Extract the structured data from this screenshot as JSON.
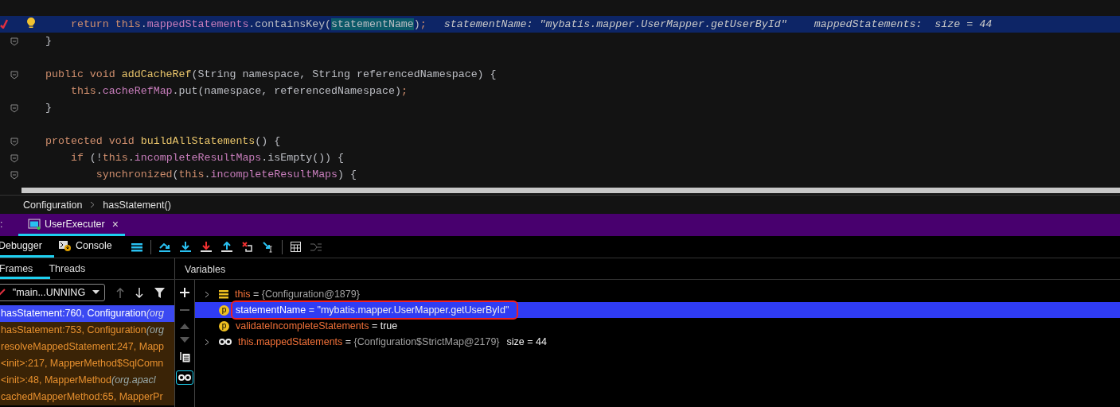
{
  "editor": {
    "lines": [
      {
        "kind": "code",
        "current": true,
        "breakpoint": true,
        "intention": true,
        "fold": false,
        "tokens": [
          {
            "kind": "kw",
            "text": "    return "
          },
          {
            "kind": "kw",
            "text": "this"
          },
          {
            "kind": "plain",
            "text": "."
          },
          {
            "kind": "field",
            "text": "mappedStatements"
          },
          {
            "kind": "plain",
            "text": ".containsKey("
          },
          {
            "kind": "usage",
            "text": "statementName"
          },
          {
            "kind": "plain",
            "text": ")"
          },
          {
            "kind": "punct",
            "text": ";"
          }
        ],
        "hints": [
          "statementName: \"mybatis.mapper.UserMapper.getUserById\"",
          "mappedStatements:  size = 44"
        ]
      },
      {
        "kind": "code",
        "current": false,
        "breakpoint": false,
        "intention": false,
        "fold": true,
        "tokens": [
          {
            "kind": "plain",
            "text": "}"
          }
        ]
      },
      {
        "kind": "blank"
      },
      {
        "kind": "code",
        "current": false,
        "breakpoint": false,
        "intention": false,
        "fold": true,
        "tokens": [
          {
            "kind": "kw",
            "text": "public void "
          },
          {
            "kind": "decl",
            "text": "addCacheRef"
          },
          {
            "kind": "plain",
            "text": "(String namespace, String referencedNamespace) {"
          }
        ]
      },
      {
        "kind": "code",
        "current": false,
        "breakpoint": false,
        "intention": false,
        "fold": false,
        "tokens": [
          {
            "kind": "kw",
            "text": "    this"
          },
          {
            "kind": "plain",
            "text": "."
          },
          {
            "kind": "field",
            "text": "cacheRefMap"
          },
          {
            "kind": "plain",
            "text": ".put(namespace, referencedNamespace)"
          },
          {
            "kind": "punct",
            "text": ";"
          }
        ]
      },
      {
        "kind": "code",
        "current": false,
        "breakpoint": false,
        "intention": false,
        "fold": true,
        "tokens": [
          {
            "kind": "plain",
            "text": "}"
          }
        ]
      },
      {
        "kind": "blank"
      },
      {
        "kind": "code",
        "current": false,
        "breakpoint": false,
        "intention": false,
        "fold": true,
        "tokens": [
          {
            "kind": "kw",
            "text": "protected void "
          },
          {
            "kind": "decl",
            "text": "buildAllStatements"
          },
          {
            "kind": "plain",
            "text": "() {"
          }
        ]
      },
      {
        "kind": "code",
        "current": false,
        "breakpoint": false,
        "intention": false,
        "fold": true,
        "tokens": [
          {
            "kind": "kw",
            "text": "    if "
          },
          {
            "kind": "plain",
            "text": "(!"
          },
          {
            "kind": "kw",
            "text": "this"
          },
          {
            "kind": "plain",
            "text": "."
          },
          {
            "kind": "field",
            "text": "incompleteResultMaps"
          },
          {
            "kind": "plain",
            "text": ".isEmpty()) {"
          }
        ]
      },
      {
        "kind": "code",
        "current": false,
        "breakpoint": false,
        "intention": false,
        "fold": true,
        "tokens": [
          {
            "kind": "kw",
            "text": "        synchronized"
          },
          {
            "kind": "plain",
            "text": "("
          },
          {
            "kind": "kw",
            "text": "this"
          },
          {
            "kind": "plain",
            "text": "."
          },
          {
            "kind": "field",
            "text": "incompleteResultMaps"
          },
          {
            "kind": "plain",
            "text": ") {"
          }
        ]
      }
    ]
  },
  "breadcrumb": [
    "Configuration",
    "hasStatement()"
  ],
  "tool_window": {
    "title": ":",
    "tab": {
      "label": "UserExecuter",
      "close": "×"
    }
  },
  "debug_tabs": [
    {
      "label": "Debugger",
      "selected": true
    },
    {
      "label": "Console",
      "selected": false
    }
  ],
  "frames_tabs": [
    {
      "label": "Frames",
      "selected": true
    },
    {
      "label": "Threads",
      "selected": false
    }
  ],
  "variables_title": "Variables",
  "thread_select": {
    "value": "\"main...UNNING"
  },
  "frames": [
    {
      "location": "hasStatement:760, Configuration",
      "package": "(org",
      "selected": true
    },
    {
      "location": "hasStatement:753, Configuration",
      "package": "(org",
      "selected": false
    },
    {
      "location": "resolveMappedStatement:247, Mapp",
      "selected": false
    },
    {
      "location": "<init>:217, MapperMethod$SqlComn",
      "selected": false
    },
    {
      "location": "<init>:48, MapperMethod",
      "package": "(org.apacl",
      "selected": false
    },
    {
      "location": "cachedMapperMethod:65, MapperPr",
      "selected": false
    }
  ],
  "variables": [
    {
      "kind": "field",
      "expandable": true,
      "name": "this",
      "operator": "=",
      "value": "{Configuration@1879}",
      "selected": false,
      "outlined": false
    },
    {
      "kind": "param",
      "badge": "p",
      "expandable": false,
      "name": "statementName",
      "operator": "=",
      "value": "\"mybatis.mapper.UserMapper.getUserById\"",
      "selected": true,
      "outlined": true
    },
    {
      "kind": "param",
      "badge": "p",
      "expandable": false,
      "name": "validateIncompleteStatements",
      "operator": "=",
      "value": "true",
      "selected": false,
      "outlined": false
    },
    {
      "kind": "watch",
      "expandable": true,
      "name": "this.mappedStatements",
      "operator": "=",
      "value": "{Configuration$StrictMap@2179}",
      "extra": "size = 44",
      "selected": false,
      "outlined": false
    }
  ]
}
